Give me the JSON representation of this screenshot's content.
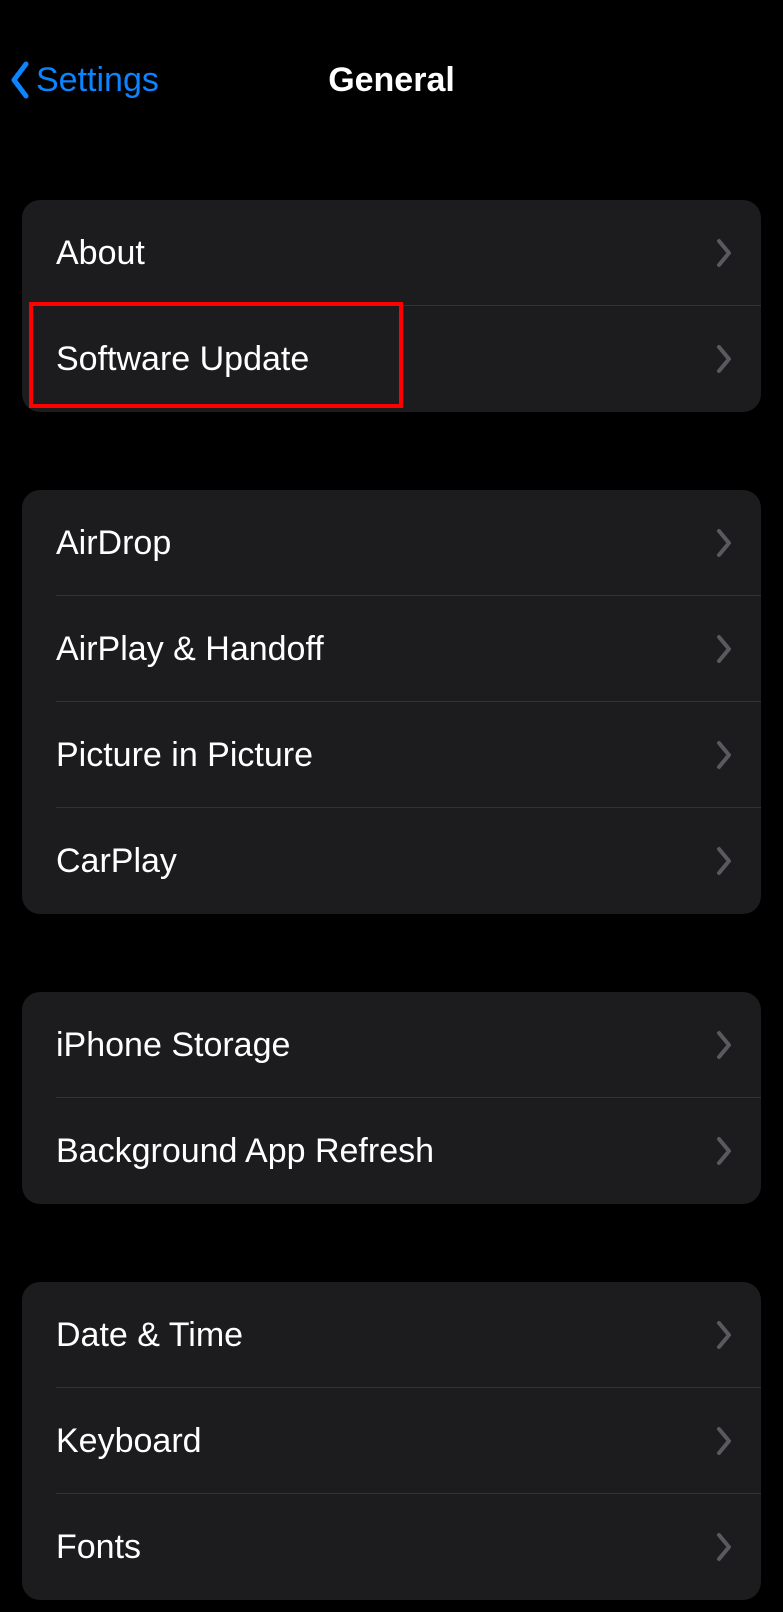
{
  "nav": {
    "back_label": "Settings",
    "title": "General"
  },
  "groups": [
    {
      "rows": [
        {
          "label": "About"
        },
        {
          "label": "Software Update",
          "highlighted": true
        }
      ]
    },
    {
      "rows": [
        {
          "label": "AirDrop"
        },
        {
          "label": "AirPlay & Handoff"
        },
        {
          "label": "Picture in Picture"
        },
        {
          "label": "CarPlay"
        }
      ]
    },
    {
      "rows": [
        {
          "label": "iPhone Storage"
        },
        {
          "label": "Background App Refresh"
        }
      ]
    },
    {
      "rows": [
        {
          "label": "Date & Time"
        },
        {
          "label": "Keyboard"
        },
        {
          "label": "Fonts"
        }
      ]
    }
  ]
}
